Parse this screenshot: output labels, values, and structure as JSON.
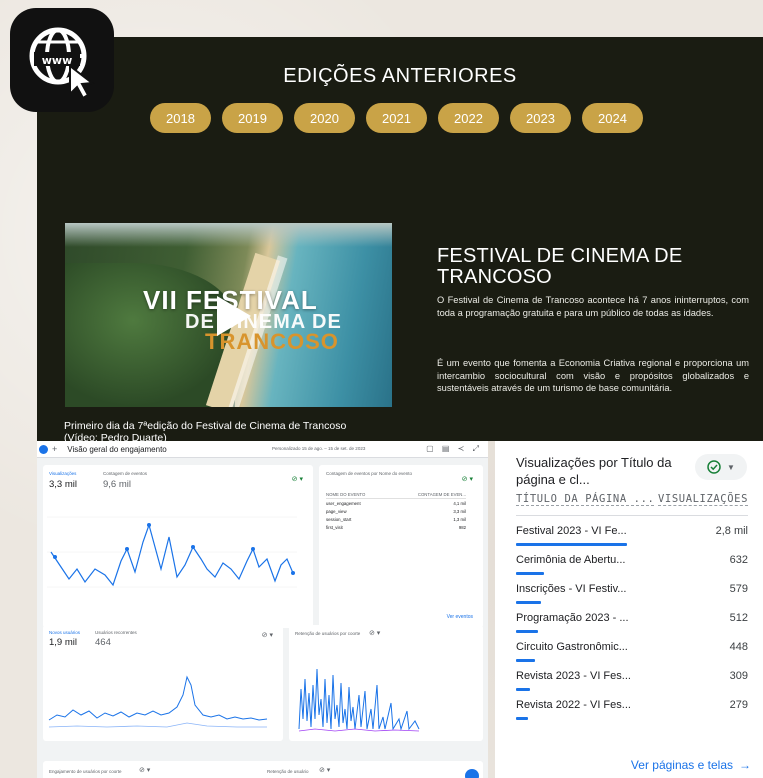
{
  "site": {
    "heading": "EDIÇÕES ANTERIORES",
    "years": [
      "2018",
      "2019",
      "2020",
      "2021",
      "2022",
      "2023",
      "2024"
    ],
    "video": {
      "title_line1": "VII FESTIVAL",
      "title_line2": "DE CINEMA DE",
      "title_line3": "TRANCOSO",
      "caption_line1": "Primeiro dia da 7ªedição do Festival de Cinema de Trancoso",
      "caption_line2": "(Vídeo: Pedro Duarte)"
    },
    "festival_title": "FESTIVAL DE CINEMA DE TRANCOSO",
    "paragraph1": "O Festival de Cinema de Trancoso acontece há 7 anos ininterruptos, com toda a programação gratuita e para um público de todas as idades.",
    "paragraph2": "É um evento que fomenta a Economia Criativa regional e proporciona um intercambio sociocultural com visão e propósitos globalizados e sustentáveis através de um turismo de base comunitária."
  },
  "dashboard": {
    "title": "Visão geral do engajamento",
    "date_range": "Personalizado  15 de ago. – 15 de set. de 2023",
    "card1": {
      "label1": "Visualizações",
      "value1": "3,3 mil",
      "label2": "Contagem de eventos",
      "value2": "9,6 mil"
    },
    "card2": {
      "title": "Contagem de eventos por Nome do evento",
      "col1": "NOME DO EVENTO",
      "col2": "CONTAGEM DE EVEN...",
      "rows": [
        {
          "name": "user_engagement",
          "value": "4,1 mil"
        },
        {
          "name": "page_view",
          "value": "3,3 mil"
        },
        {
          "name": "session_start",
          "value": "1,3 mil"
        },
        {
          "name": "first_visit",
          "value": "982"
        }
      ],
      "link": "Ver eventos"
    },
    "card3": {
      "label1": "Novos usuários",
      "value1": "1,9 mil",
      "label2": "Usuários recorrentes",
      "value2": "464"
    },
    "card4": {
      "title": "Retenção de usuários por coorte"
    },
    "card5": {
      "title": "Engajamento de usuários por coorte"
    },
    "card6": {
      "title": "Retenção de usuário"
    }
  },
  "panel": {
    "title": "Visualizações por Título da página e cl...",
    "col_title": "TÍTULO DA PÁGINA ...",
    "col_views": "VISUALIZAÇÕES",
    "rows": [
      {
        "label": "Festival 2023 - VI Fe...",
        "value": "2,8 mil",
        "pct": 0.2
      },
      {
        "label": "Cerimônia de Abertu...",
        "value": "632",
        "pct": 0.05
      },
      {
        "label": "Inscrições - VI Festiv...",
        "value": "579",
        "pct": 0.045
      },
      {
        "label": "Programação 2023 - ...",
        "value": "512",
        "pct": 0.04
      },
      {
        "label": "Circuito Gastronômic...",
        "value": "448",
        "pct": 0.035
      },
      {
        "label": "Revista 2023 - VI Fes...",
        "value": "309",
        "pct": 0.025
      },
      {
        "label": "Revista 2022 - VI Fes...",
        "value": "279",
        "pct": 0.022
      }
    ],
    "link": "Ver páginas e telas"
  },
  "colors": {
    "gold": "#c9a347",
    "dark_bg": "#1a1c12",
    "ga_blue": "#1a73e8"
  }
}
